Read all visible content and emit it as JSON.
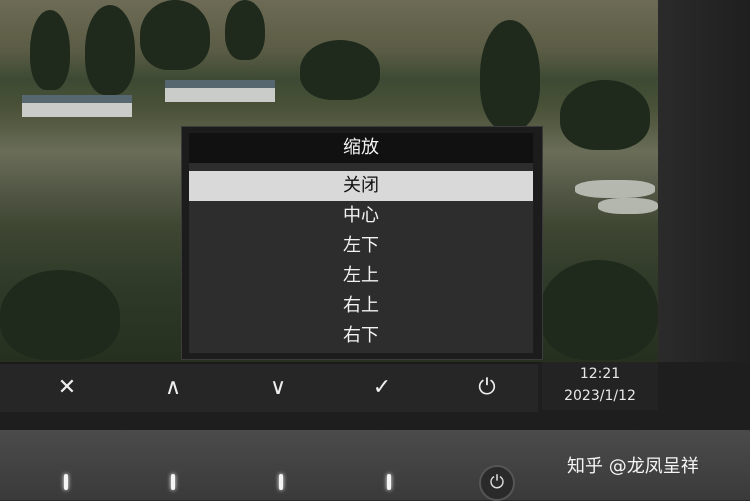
{
  "osd": {
    "title": "缩放",
    "items": [
      {
        "label": "关闭",
        "selected": true
      },
      {
        "label": "中心",
        "selected": false
      },
      {
        "label": "左下",
        "selected": false
      },
      {
        "label": "左上",
        "selected": false
      },
      {
        "label": "右上",
        "selected": false
      },
      {
        "label": "右下",
        "selected": false
      }
    ]
  },
  "buttons": {
    "close": "✕",
    "up": "∧",
    "down": "∨",
    "confirm": "✓",
    "power": "⏻"
  },
  "clock": {
    "time": "12:21",
    "date": "2023/1/12"
  },
  "physical_power": "⏻",
  "watermark": "知乎 @龙凤呈祥",
  "colors": {
    "osd_selected_bg": "#d9d9d9",
    "osd_bg": "#2d2d2d",
    "osd_title_bg": "#111111"
  }
}
